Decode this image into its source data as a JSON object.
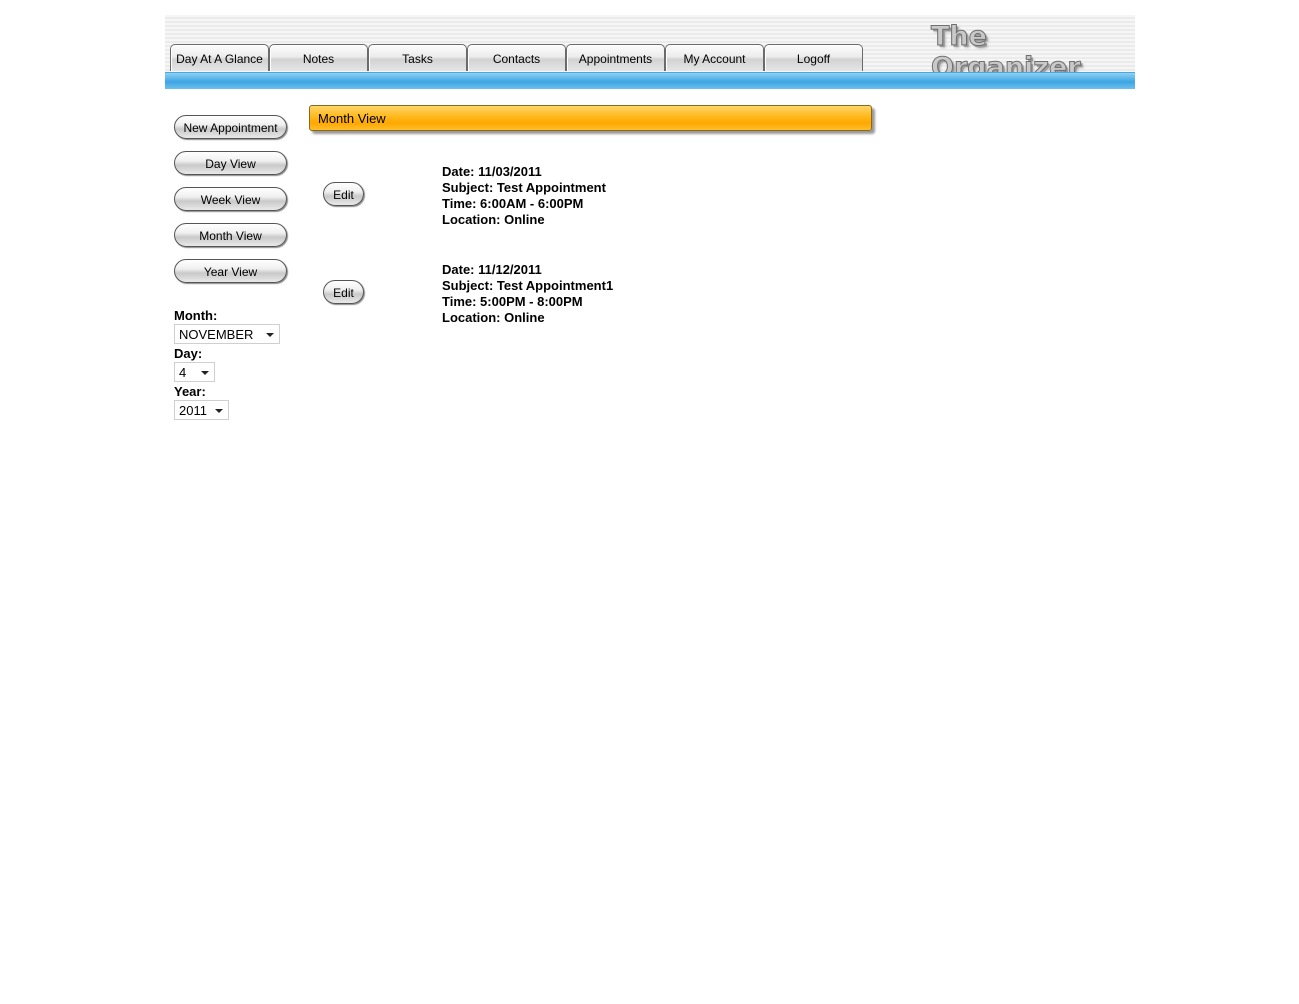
{
  "app": {
    "logo_text": "The Organizer"
  },
  "nav": {
    "tabs": [
      {
        "label": "Day At A Glance"
      },
      {
        "label": "Notes"
      },
      {
        "label": "Tasks"
      },
      {
        "label": "Contacts"
      },
      {
        "label": "Appointments"
      },
      {
        "label": "My Account"
      },
      {
        "label": "Logoff"
      }
    ]
  },
  "sidebar": {
    "buttons": [
      {
        "label": "New Appointment"
      },
      {
        "label": "Day View"
      },
      {
        "label": "Week View"
      },
      {
        "label": "Month View"
      },
      {
        "label": "Year View"
      }
    ],
    "month": {
      "label": "Month:",
      "value": "NOVEMBER"
    },
    "day": {
      "label": "Day:",
      "value": "4"
    },
    "year": {
      "label": "Year:",
      "value": "2011"
    }
  },
  "main": {
    "title": "Month View",
    "edit_label": "Edit",
    "appointments": [
      {
        "date": "Date: 11/03/2011",
        "subject": "Subject: Test Appointment",
        "time": "Time: 6:00AM - 6:00PM",
        "location": "Location: Online"
      },
      {
        "date": "Date: 11/12/2011",
        "subject": "Subject: Test Appointment1",
        "time": "Time: 5:00PM - 8:00PM",
        "location": "Location: Online"
      }
    ]
  },
  "colors": {
    "accent_blue": "#3ea5e3",
    "panel_orange": "#ffa800"
  }
}
